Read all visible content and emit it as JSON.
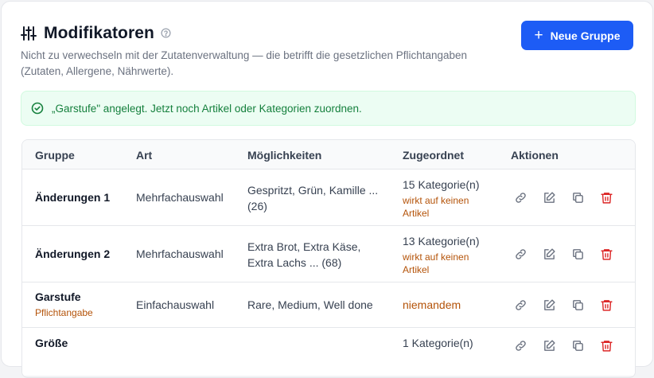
{
  "header": {
    "title": "Modifikatoren",
    "subtitle": "Nicht zu verwechseln mit der Zutatenverwaltung — die betrifft die gesetzlichen Pflichtangaben (Zutaten, Allergene, Nährwerte).",
    "new_group_label": "Neue Gruppe"
  },
  "alert": {
    "message": "„Garstufe\" angelegt. Jetzt noch Artikel oder Kategorien zuordnen."
  },
  "table": {
    "columns": [
      "Gruppe",
      "Art",
      "Möglichkeiten",
      "Zugeordnet",
      "Aktionen"
    ],
    "rows": [
      {
        "group": "Änderungen 1",
        "type": "Mehrfachauswahl",
        "options_line1": "Gespritzt, Grün, Kamille ...",
        "options_line2": "(26)",
        "assigned": "15 Kategorie(n)",
        "warn_line1": "wirkt auf keinen",
        "warn_line2": "Artikel"
      },
      {
        "group": "Änderungen 2",
        "type": "Mehrfachauswahl",
        "options_line1": "Extra Brot, Extra Käse,",
        "options_line2": "Extra Lachs ... (68)",
        "assigned": "13 Kategorie(n)",
        "warn_line1": "wirkt auf keinen",
        "warn_line2": "Artikel"
      },
      {
        "group": "Garstufe",
        "tag": "Pflichtangabe",
        "type": "Einfachauswahl",
        "options_line1": "Rare, Medium, Well done",
        "assigned": "niemandem"
      },
      {
        "group": "Größe",
        "assigned": "1 Kategorie(n)"
      }
    ]
  },
  "colors": {
    "primary": "#1d5cf5",
    "success_bg": "#ecfdf3",
    "success_text": "#15803d",
    "warning_text": "#b45309",
    "danger": "#dc2626"
  },
  "icons": {
    "title": "sliders-icon",
    "help": "question-circle-icon",
    "add": "plus-icon",
    "success": "check-circle-icon",
    "actions": [
      "link-icon",
      "edit-icon",
      "copy-icon",
      "trash-icon"
    ]
  }
}
